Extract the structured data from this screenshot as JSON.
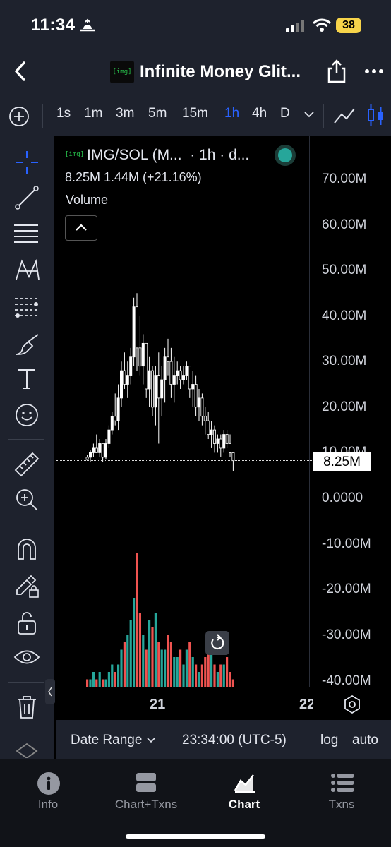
{
  "status_bar": {
    "time": "11:34",
    "battery": "38"
  },
  "header": {
    "title": "Infinite Money Glit...",
    "logo_text": "[img]"
  },
  "timeframes": [
    {
      "label": "1s",
      "active": false
    },
    {
      "label": "1m",
      "active": false
    },
    {
      "label": "3m",
      "active": false
    },
    {
      "label": "5m",
      "active": false
    },
    {
      "label": "15m",
      "active": false
    },
    {
      "label": "1h",
      "active": true
    },
    {
      "label": "4h",
      "active": false
    },
    {
      "label": "D",
      "active": false
    }
  ],
  "accent_color": "#2962ff",
  "chart_legend": {
    "symbol": "IMG/SOL (M...",
    "interval": "· 1h · d...",
    "icon_text": "[img]",
    "values_line": "8.25M  1.44M  (+21.16%)",
    "indicator": "Volume"
  },
  "chart_data": {
    "type": "candlestick+volume",
    "y_axis_labels": [
      "70.00M",
      "60.00M",
      "50.00M",
      "40.00M",
      "30.00M",
      "20.00M",
      "10.00M",
      "0.0000",
      "-10.00M",
      "-20.00M",
      "-30.00M",
      "-40.00M"
    ],
    "y_range": [
      -40000000,
      70000000
    ],
    "last_price_label": "8.25M",
    "x_axis_labels": [
      "21",
      "22"
    ],
    "candles": [
      [
        9,
        9.5,
        8.5,
        8.5
      ],
      [
        9,
        10.5,
        8,
        10
      ],
      [
        10,
        12,
        9,
        11
      ],
      [
        11,
        14,
        10,
        10
      ],
      [
        10,
        13,
        9,
        12
      ],
      [
        12,
        11,
        8,
        9
      ],
      [
        9,
        13,
        8.5,
        12
      ],
      [
        12,
        16,
        11,
        15
      ],
      [
        15,
        19,
        14,
        18
      ],
      [
        18,
        23,
        16,
        17
      ],
      [
        17,
        25,
        15,
        22
      ],
      [
        22,
        30,
        20,
        28
      ],
      [
        28,
        32,
        24,
        25
      ],
      [
        25,
        30,
        22,
        27
      ],
      [
        27,
        33,
        25,
        31
      ],
      [
        31,
        44,
        29,
        42
      ],
      [
        42,
        45,
        28,
        33
      ],
      [
        33,
        40,
        27,
        29
      ],
      [
        29,
        36,
        25,
        34
      ],
      [
        34,
        33,
        22,
        24
      ],
      [
        24,
        31,
        20,
        28
      ],
      [
        28,
        29,
        18,
        20
      ],
      [
        20,
        29,
        16,
        27
      ],
      [
        27,
        32,
        12,
        22
      ],
      [
        22,
        29,
        18,
        26
      ],
      [
        26,
        33,
        21,
        31
      ],
      [
        31,
        35,
        27,
        30
      ],
      [
        30,
        33,
        22,
        25
      ],
      [
        25,
        31,
        21,
        27
      ],
      [
        27,
        30,
        25,
        28
      ],
      [
        28,
        29,
        24,
        26
      ],
      [
        26,
        29,
        25,
        27
      ],
      [
        27,
        30,
        26,
        29
      ],
      [
        29,
        28,
        22,
        24
      ],
      [
        24,
        28,
        20,
        25
      ],
      [
        25,
        27,
        18,
        20
      ],
      [
        20,
        24,
        17,
        22
      ],
      [
        22,
        23,
        16,
        18
      ],
      [
        18,
        20,
        14,
        17
      ],
      [
        17,
        19,
        13,
        14
      ],
      [
        14,
        17,
        11,
        15
      ],
      [
        15,
        16,
        10,
        12
      ],
      [
        12,
        14,
        10,
        13
      ],
      [
        13,
        14,
        9,
        11
      ],
      [
        11,
        15,
        10,
        14
      ],
      [
        14,
        15,
        11,
        12
      ],
      [
        12,
        14,
        9,
        10
      ],
      [
        10,
        9,
        6,
        8.25
      ]
    ],
    "volume": [
      1,
      1,
      2,
      1,
      2,
      1,
      1,
      2,
      3,
      2,
      3,
      5,
      6,
      7,
      9,
      12,
      18,
      10,
      7,
      5,
      9,
      8,
      10,
      6,
      5,
      5,
      7,
      6,
      4,
      4,
      5,
      3,
      5,
      6,
      4,
      3,
      2,
      3,
      4,
      6,
      5,
      3,
      2,
      3,
      3,
      4,
      2,
      1
    ]
  },
  "price_axis_mode": {
    "log": "log",
    "auto": "auto"
  },
  "range_bar": {
    "date_range": "Date Range",
    "time": "23:34:00 (UTC-5)"
  },
  "tabs": [
    {
      "label": "Info",
      "icon": "info-icon",
      "active": false
    },
    {
      "label": "Chart+Txns",
      "icon": "split-view-icon",
      "active": false
    },
    {
      "label": "Chart",
      "icon": "area-chart-icon",
      "active": true
    },
    {
      "label": "Txns",
      "icon": "list-icon",
      "active": false
    }
  ],
  "colors": {
    "up": "#26a69a",
    "down": "#ef5350",
    "candle": "#ffffff",
    "panel": "#1e222d"
  }
}
